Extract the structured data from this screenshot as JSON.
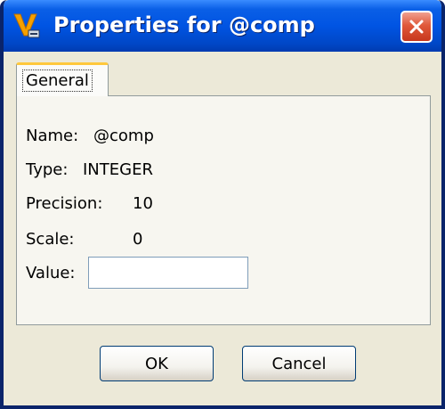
{
  "window": {
    "title": "Properties for @comp"
  },
  "tabs": [
    {
      "label": "General",
      "selected": true
    }
  ],
  "fields": {
    "name_label": "Name:",
    "name_value": "@comp",
    "type_label": "Type:",
    "type_value": "INTEGER",
    "precision_label": "Precision:",
    "precision_value": "10",
    "scale_label": "Scale:",
    "scale_value": "0",
    "value_label": "Value:",
    "value_input": ""
  },
  "buttons": {
    "ok_label": "OK",
    "cancel_label": "Cancel"
  },
  "icons": {
    "app": "v-logo-icon",
    "close": "close-icon"
  },
  "colors": {
    "titlebar": "#0054e3",
    "close_button": "#e0593a",
    "dialog_background": "#ece9d8",
    "tab_highlight": "#ffc83c"
  }
}
